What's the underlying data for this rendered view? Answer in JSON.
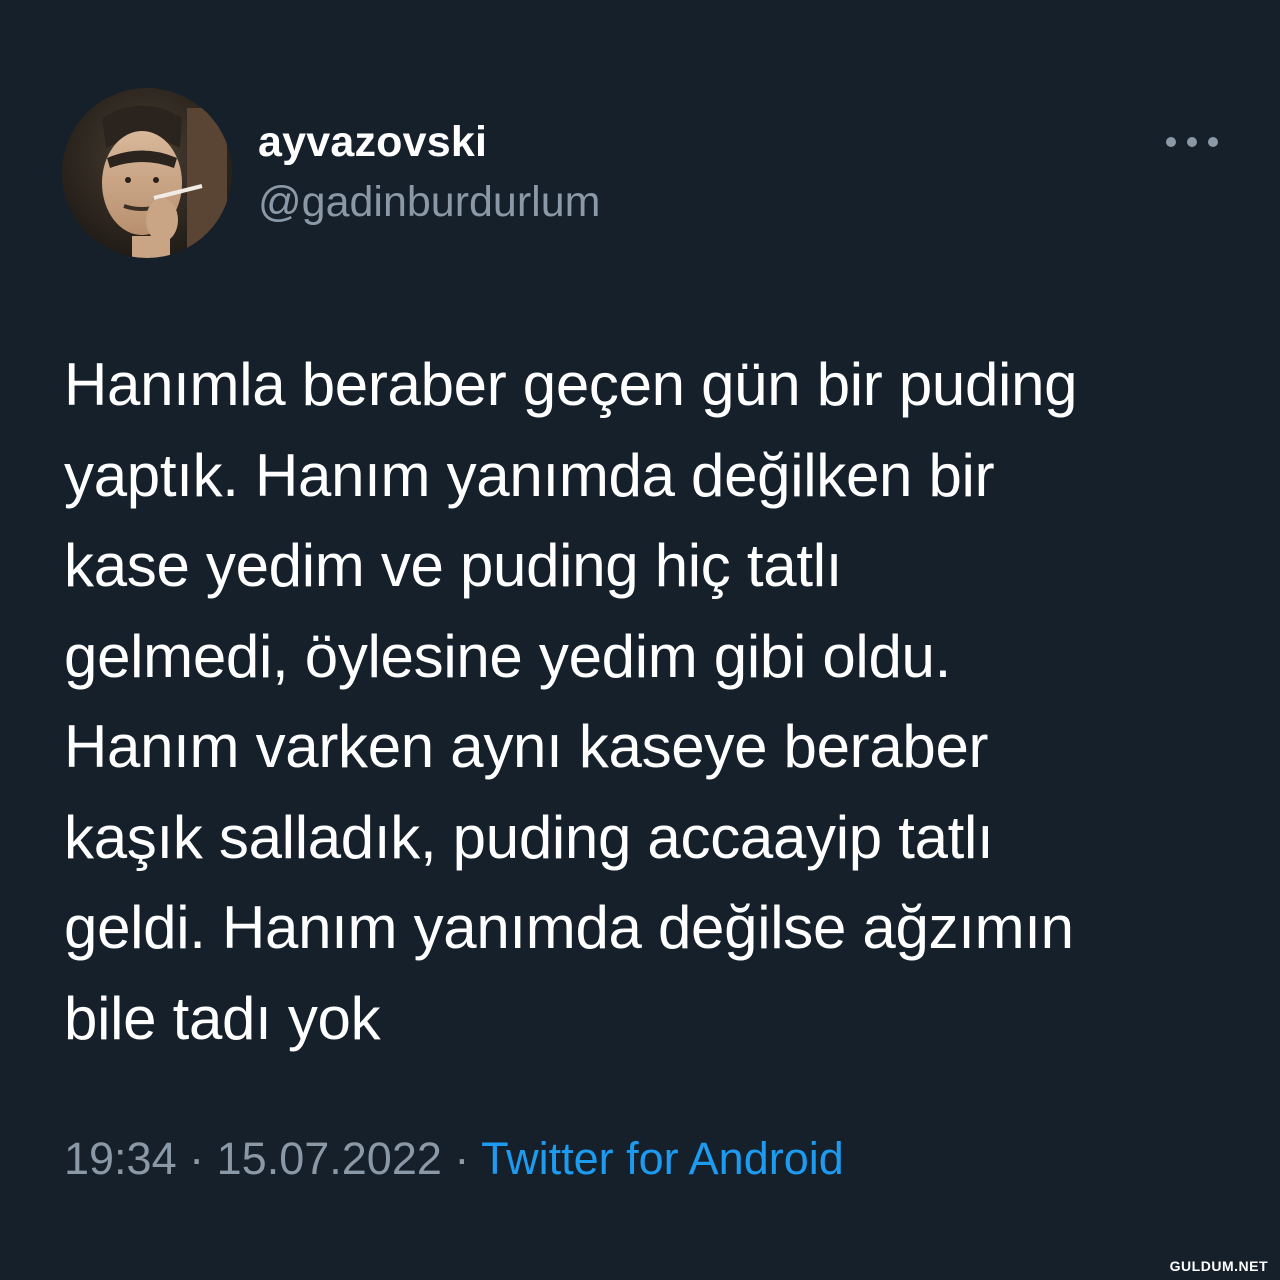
{
  "user": {
    "display_name": "ayvazovski",
    "handle": "@gadinburdurlum",
    "avatar_icon": "profile-photo"
  },
  "menu": {
    "more_icon": "more-horizontal-icon"
  },
  "tweet": {
    "lines": [
      "Hanımla beraber geçen gün bir puding",
      "yaptık. Hanım yanımda değilken bir",
      "kase yedim ve puding hiç tatlı",
      "gelmedi, öylesine yedim gibi oldu.",
      "Hanım varken aynı kaseye beraber",
      "kaşık salladık, puding accaayip tatlı",
      "geldi. Hanım yanımda değilse ağzımın",
      "bile tadı yok"
    ]
  },
  "meta": {
    "time": "19:34",
    "separator": "·",
    "date": "15.07.2022",
    "source": "Twitter for Android"
  },
  "watermark": "GULDUM.NET",
  "colors": {
    "background": "#15202b",
    "text": "#ffffff",
    "secondary": "#8b98a5",
    "link": "#1d9bf0"
  }
}
